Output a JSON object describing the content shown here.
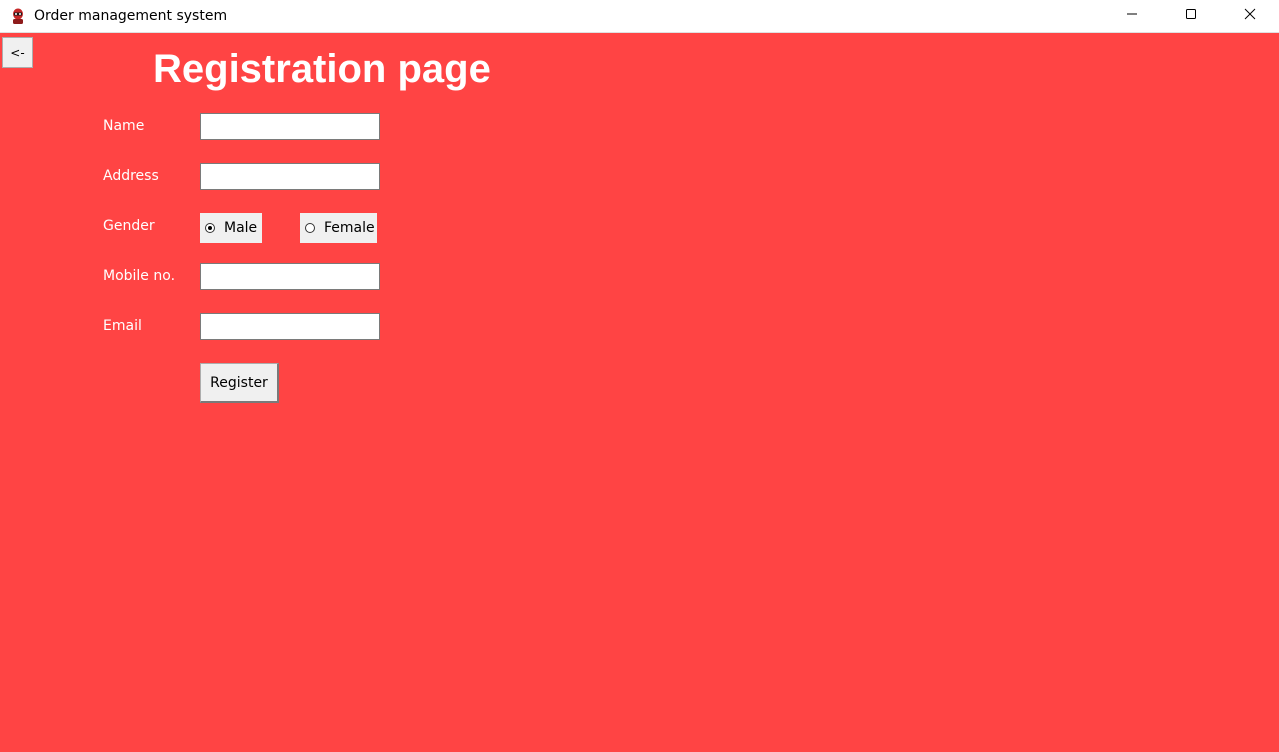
{
  "window": {
    "title": "Order management system",
    "app_icon": "deadpool-icon",
    "controls": [
      "minimize-icon",
      "maximize-icon",
      "close-icon"
    ],
    "background_color": "#ff4444"
  },
  "back_button": {
    "label": "<-"
  },
  "page": {
    "title": "Registration page"
  },
  "form": {
    "name_label": "Name",
    "name_value": "",
    "address_label": "Address",
    "address_value": "",
    "gender_label": "Gender",
    "gender_options": [
      "Male",
      "Female"
    ],
    "gender_selected": "Male",
    "mobile_label": "Mobile no.",
    "mobile_value": "",
    "email_label": "Email",
    "email_value": "",
    "register_label": "Register"
  }
}
